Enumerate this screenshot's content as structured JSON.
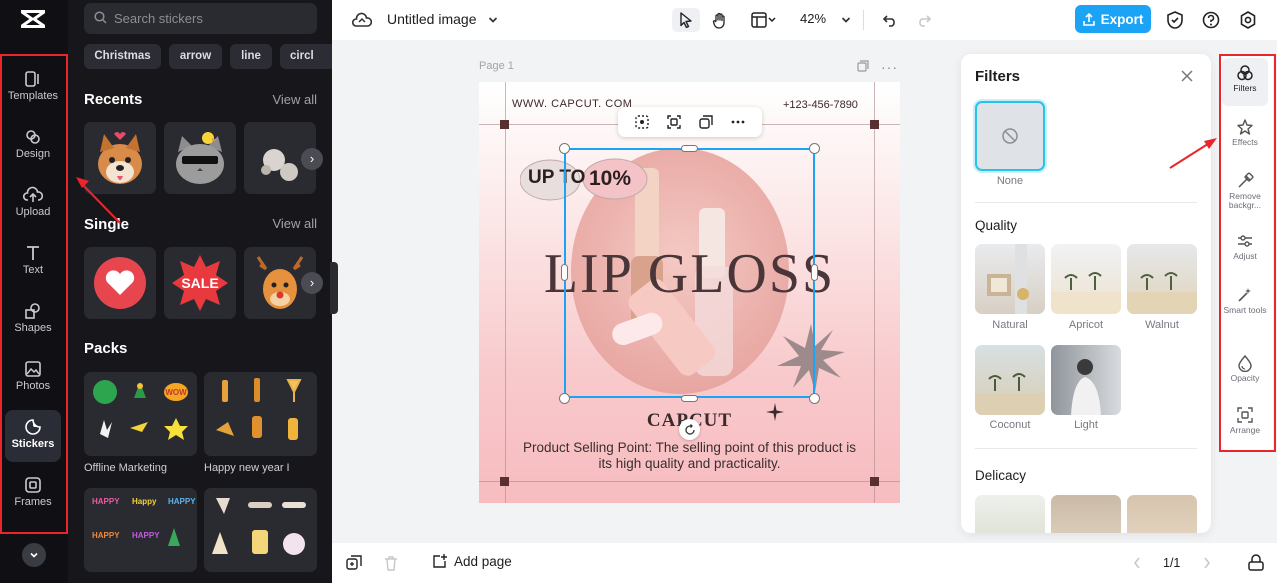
{
  "rail": {
    "items": [
      {
        "label": "Templates",
        "icon": "templates-icon"
      },
      {
        "label": "Design",
        "icon": "design-icon"
      },
      {
        "label": "Upload",
        "icon": "upload-icon"
      },
      {
        "label": "Text",
        "icon": "text-icon"
      },
      {
        "label": "Shapes",
        "icon": "shapes-icon"
      },
      {
        "label": "Photos",
        "icon": "photos-icon"
      },
      {
        "label": "Stickers",
        "icon": "stickers-icon",
        "active": true
      },
      {
        "label": "Frames",
        "icon": "frames-icon"
      }
    ]
  },
  "panel": {
    "search_placeholder": "Search stickers",
    "chips": [
      "Christmas",
      "arrow",
      "line",
      "circl"
    ],
    "recents_title": "Recents",
    "single_title": "Single",
    "packs_title": "Packs",
    "view_all": "View all",
    "packs": [
      "Offline Marketing",
      "Happy new year I"
    ]
  },
  "topbar": {
    "title": "Untitled image",
    "zoom": "42%",
    "export_label": "Export"
  },
  "canvas": {
    "page_label": "Page 1",
    "website": "WWW. CAPCUT. COM",
    "phone": "+123-456-7890",
    "badge_a": "UP TO",
    "badge_b": "10%",
    "headline": "LIP GLOSS",
    "brand": "CAPCUT",
    "selling_point": "Product Selling Point: The selling point of this product is its high quality and practicality."
  },
  "filters": {
    "title": "Filters",
    "none_label": "None",
    "quality_title": "Quality",
    "quality_items": [
      "Natural",
      "Apricot",
      "Walnut",
      "Coconut",
      "Light"
    ],
    "delicacy_title": "Delicacy"
  },
  "tools": {
    "items": [
      {
        "label": "Filters",
        "active": true
      },
      {
        "label": "Effects"
      },
      {
        "label": "Remove backgr..."
      },
      {
        "label": "Adjust"
      },
      {
        "label": "Smart tools"
      },
      {
        "label": "Opacity"
      },
      {
        "label": "Arrange"
      }
    ]
  },
  "bottombar": {
    "add_page": "Add page",
    "page_count": "1/1"
  },
  "colors": {
    "accent": "#1ba3f5",
    "annotation": "#e8262b",
    "dark_panel": "#17171b"
  }
}
